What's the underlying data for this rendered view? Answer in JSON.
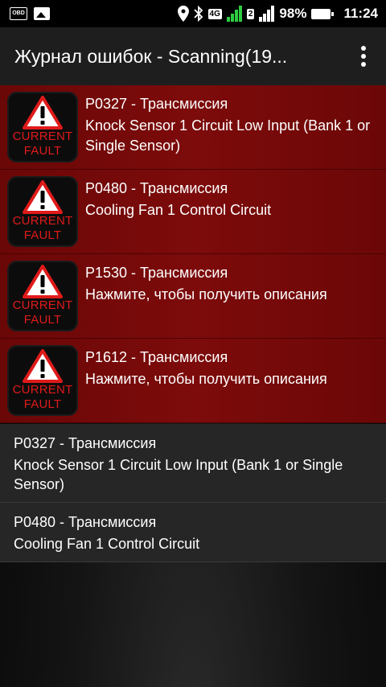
{
  "status_bar": {
    "left_icons": [
      "obd-icon",
      "image-icon"
    ],
    "obd_label": "OBD",
    "network_label": "4G",
    "sim2_label": "2",
    "battery": "98%",
    "time": "11:24"
  },
  "app_bar": {
    "title": "Журнал ошибок - Scanning(19...",
    "overflow_icon": "more-vert-icon"
  },
  "fault_badge": {
    "line1": "CURRENT",
    "line2": "FAULT",
    "color": "#e01a1a"
  },
  "current_faults": [
    {
      "code": "P0327 - Трансмиссия",
      "description": "Knock Sensor 1 Circuit Low Input (Bank 1 or Single Sensor)"
    },
    {
      "code": "P0480 - Трансмиссия",
      "description": "Cooling Fan 1 Control Circuit"
    },
    {
      "code": "P1530 - Трансмиссия",
      "description": "Нажмите, чтобы получить описания"
    },
    {
      "code": "P1612 - Трансмиссия",
      "description": "Нажмите, чтобы получить описания"
    }
  ],
  "other_faults": [
    {
      "code": "P0327 - Трансмиссия",
      "description": "Knock Sensor 1 Circuit Low Input (Bank 1 or Single Sensor)"
    },
    {
      "code": "P0480 - Трансмиссия",
      "description": "Cooling Fan 1 Control Circuit"
    }
  ]
}
